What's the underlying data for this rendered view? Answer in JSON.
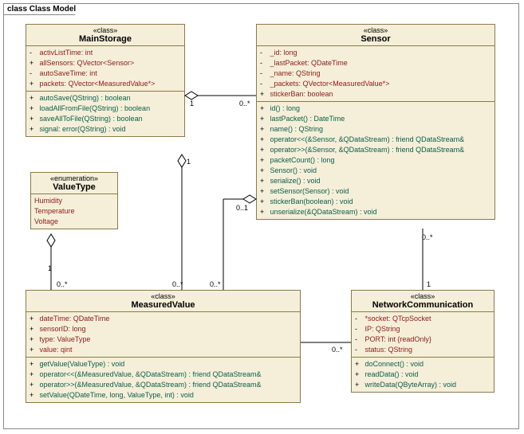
{
  "title": "class Class Model",
  "classes": {
    "MainStorage": {
      "stereotype": "«class»",
      "name": "MainStorage",
      "attrs": [
        {
          "vis": "-",
          "name": "activListTime",
          "type": "int"
        },
        {
          "vis": "+",
          "name": "allSensors",
          "type": "QVector<Sensor>"
        },
        {
          "vis": "-",
          "name": "autoSaveTime",
          "type": "int"
        },
        {
          "vis": "+",
          "name": "packets",
          "type": "QVector<MeasuredValue*>"
        }
      ],
      "ops": [
        {
          "vis": "+",
          "sig": "autoSave(QString) : boolean"
        },
        {
          "vis": "+",
          "sig": "loadAllFromFile(QString) : boolean"
        },
        {
          "vis": "+",
          "sig": "saveAllToFile(QString) : boolean"
        },
        {
          "vis": "+",
          "sig": "signal: error(QString) : void"
        }
      ]
    },
    "Sensor": {
      "stereotype": "«class»",
      "name": "Sensor",
      "attrs": [
        {
          "vis": "-",
          "name": "_id",
          "type": "long"
        },
        {
          "vis": "-",
          "name": "_lastPacket",
          "type": "QDateTime"
        },
        {
          "vis": "-",
          "name": "_name",
          "type": "QString"
        },
        {
          "vis": "-",
          "name": "_packets",
          "type": "QVector<MeasuredValue*>"
        },
        {
          "vis": "+",
          "name": "stickerBan",
          "type": "boolean"
        }
      ],
      "ops": [
        {
          "vis": "+",
          "sig": "id() : long"
        },
        {
          "vis": "+",
          "sig": "lastPacket() : DateTime"
        },
        {
          "vis": "+",
          "sig": "name() : QString"
        },
        {
          "vis": "+",
          "sig": "operator<<(&Sensor, &QDataStream) : friend QDataStream&"
        },
        {
          "vis": "+",
          "sig": "operator>>(&Sensor, &QDataStream) : friend QDataStream&"
        },
        {
          "vis": "+",
          "sig": "packetCount() : long"
        },
        {
          "vis": "+",
          "sig": "Sensor() : void"
        },
        {
          "vis": "+",
          "sig": "serialize() : void"
        },
        {
          "vis": "+",
          "sig": "setSensor(Sensor) : void"
        },
        {
          "vis": "+",
          "sig": "stickerBan(boolean) : void"
        },
        {
          "vis": "+",
          "sig": "unserialize(&QDataStream) : void"
        }
      ]
    },
    "ValueType": {
      "stereotype": "«enumeration»",
      "name": "ValueType",
      "literals": [
        "Humidity",
        "Temperature",
        "Voltage"
      ]
    },
    "MeasuredValue": {
      "stereotype": "«class»",
      "name": "MeasuredValue",
      "attrs": [
        {
          "vis": "+",
          "name": "dateTime",
          "type": "QDateTime"
        },
        {
          "vis": "+",
          "name": "sensorID",
          "type": "long"
        },
        {
          "vis": "+",
          "name": "type",
          "type": "ValueType"
        },
        {
          "vis": "+",
          "name": "value",
          "type": "qint"
        }
      ],
      "ops": [
        {
          "vis": "+",
          "sig": "getValue(ValueType) : void"
        },
        {
          "vis": "+",
          "sig": "operator<<(&MeasuredValue, &QDataStream) : friend QDataStream&"
        },
        {
          "vis": "+",
          "sig": "operator>>(&MeasuredValue, &QDataStream) : friend QDataStream&"
        },
        {
          "vis": "+",
          "sig": "setValue(QDateTime, long, ValueType, int) : void"
        }
      ]
    },
    "NetworkCommunication": {
      "stereotype": "«class»",
      "name": "NetworkCommunication",
      "attrs": [
        {
          "vis": "-",
          "name": "*socket",
          "type": "QTcpSocket"
        },
        {
          "vis": "-",
          "name": "IP",
          "type": "QString"
        },
        {
          "vis": "-",
          "name": "PORT",
          "type": "int {readOnly}"
        },
        {
          "vis": "-",
          "name": "status",
          "type": "QString"
        }
      ],
      "ops": [
        {
          "vis": "+",
          "sig": "doConnect() : void"
        },
        {
          "vis": "+",
          "sig": "readData() : void"
        },
        {
          "vis": "+",
          "sig": "writeData(QByteArray) : void"
        }
      ]
    }
  },
  "mult": {
    "ms_sensor_1": "1",
    "ms_sensor_0n": "0..*",
    "ms_mv_1": "1",
    "ms_mv_0n": "0..*",
    "vt_mv_1": "1",
    "vt_mv_0n": "0..*",
    "sensor_mv_01": "0..1",
    "sensor_mv_0n": "0..*",
    "sensor_nc_0n": "0..*",
    "sensor_nc_1": "1",
    "nc_mv_0n": "0..*"
  }
}
